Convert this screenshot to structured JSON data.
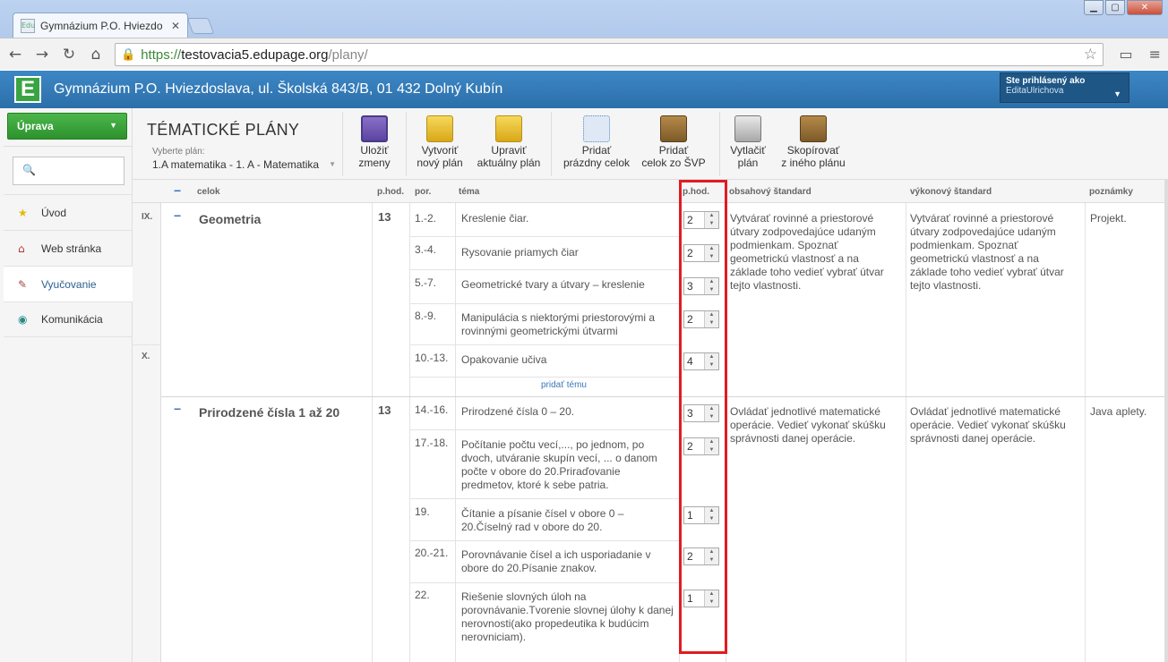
{
  "browser": {
    "tab_title": "Gymnázium P.O. Hviezdo",
    "tab_favicon": "Edu",
    "url_scheme": "https://",
    "url_domain": "testovacia5.edupage.org",
    "url_path": "/plany/"
  },
  "app": {
    "logo_letter": "E",
    "school_name": "Gymnázium P.O. Hviezdoslava, ul. Školská 843/B, 01 432 Dolný Kubín",
    "user_label": "Ste prihlásený ako",
    "user_name": "EditaUlrichova"
  },
  "sidebar": {
    "edit_button": "Úprava",
    "items": [
      {
        "label": "Úvod",
        "icon": "star-icon"
      },
      {
        "label": "Web stránka",
        "icon": "house-icon"
      },
      {
        "label": "Vyučovanie",
        "icon": "teacher-icon"
      },
      {
        "label": "Komunikácia",
        "icon": "globe-icon"
      }
    ]
  },
  "ribbon": {
    "title": "TÉMATICKÉ PLÁNY",
    "select_label": "Vyberte plán:",
    "select_value": "1.A matematika - 1. A - Matematika",
    "buttons": [
      {
        "l1": "Uložiť",
        "l2": "zmeny"
      },
      {
        "l1": "Vytvoriť",
        "l2": "nový plán"
      },
      {
        "l1": "Upraviť",
        "l2": "aktuálny plán"
      },
      {
        "l1": "Pridať",
        "l2": "prázdny celok"
      },
      {
        "l1": "Pridať",
        "l2": "celok zo ŠVP"
      },
      {
        "l1": "Vytlačiť",
        "l2": "plán"
      },
      {
        "l1": "Skopírovať",
        "l2": "z iného plánu"
      }
    ]
  },
  "table": {
    "headers": {
      "celok": "celok",
      "phod": "p.hod.",
      "por": "por.",
      "tema": "téma",
      "phod2": "p.hod.",
      "obsah": "obsahový štandard",
      "vykon": "výkonový štandard",
      "pozn": "poznámky"
    },
    "months": [
      "IX.",
      "X."
    ],
    "add_topic": "pridať tému",
    "units": [
      {
        "name": "Geometria",
        "hours": "13",
        "content_std": "Vytvárať rovinné a priestorové útvary zodpovedajúce udaným podmienkam.   Spoznať geometrickú vlastnosť a na základe toho vedieť vybrať útvar tejto vlastnosti.",
        "perf_std": "Vytvárať rovinné a priestorové útvary zodpovedajúce udaným podmienkam.   Spoznať geometrickú vlastnosť a na základe toho vedieť vybrať útvar tejto vlastnosti.",
        "note": "Projekt.",
        "topics": [
          {
            "por": "1.-2.",
            "tema": "Kreslenie čiar.",
            "hod": "2"
          },
          {
            "por": "3.-4.",
            "tema": "Rysovanie priamych čiar",
            "hod": "2"
          },
          {
            "por": "5.-7.",
            "tema": "Geometrické tvary a útvary – kreslenie",
            "hod": "3"
          },
          {
            "por": "8.-9.",
            "tema": "Manipulácia s niektorými priestorovými a rovinnými geometrickými útvarmi",
            "hod": "2"
          },
          {
            "por": "10.-13.",
            "tema": "Opakovanie učiva",
            "hod": "4"
          }
        ]
      },
      {
        "name": "Prirodzené čísla 1 až 20",
        "hours": "13",
        "content_std": "Ovládať jednotlivé matematické operácie. Vedieť vykonať skúšku správnosti danej operácie.",
        "perf_std": "Ovládať jednotlivé matematické operácie. Vedieť vykonať skúšku správnosti danej operácie.",
        "note": "Java aplety.",
        "topics": [
          {
            "por": "14.-16.",
            "tema": "Prirodzené čísla 0 – 20.",
            "hod": "3"
          },
          {
            "por": "17.-18.",
            "tema": "Počítanie počtu vecí,..., po jednom, po dvoch, utváranie skupín vecí, ... o danom počte v obore do 20.Priraďovanie predmetov, ktoré k sebe patria.",
            "hod": "2"
          },
          {
            "por": "19.",
            "tema": "Čítanie a písanie čísel v obore 0 – 20.Číselný rad v obore do 20.",
            "hod": "1"
          },
          {
            "por": "20.-21.",
            "tema": "Porovnávanie čísel a ich usporiadanie v obore do 20.Písanie znakov.",
            "hod": "2"
          },
          {
            "por": "22.",
            "tema": "Riešenie slovných úloh na porovnávanie.Tvorenie slovnej úlohy k danej nerovnosti(ako propedeutika k budúcim nerovniciam).",
            "hod": "1"
          }
        ]
      }
    ]
  }
}
